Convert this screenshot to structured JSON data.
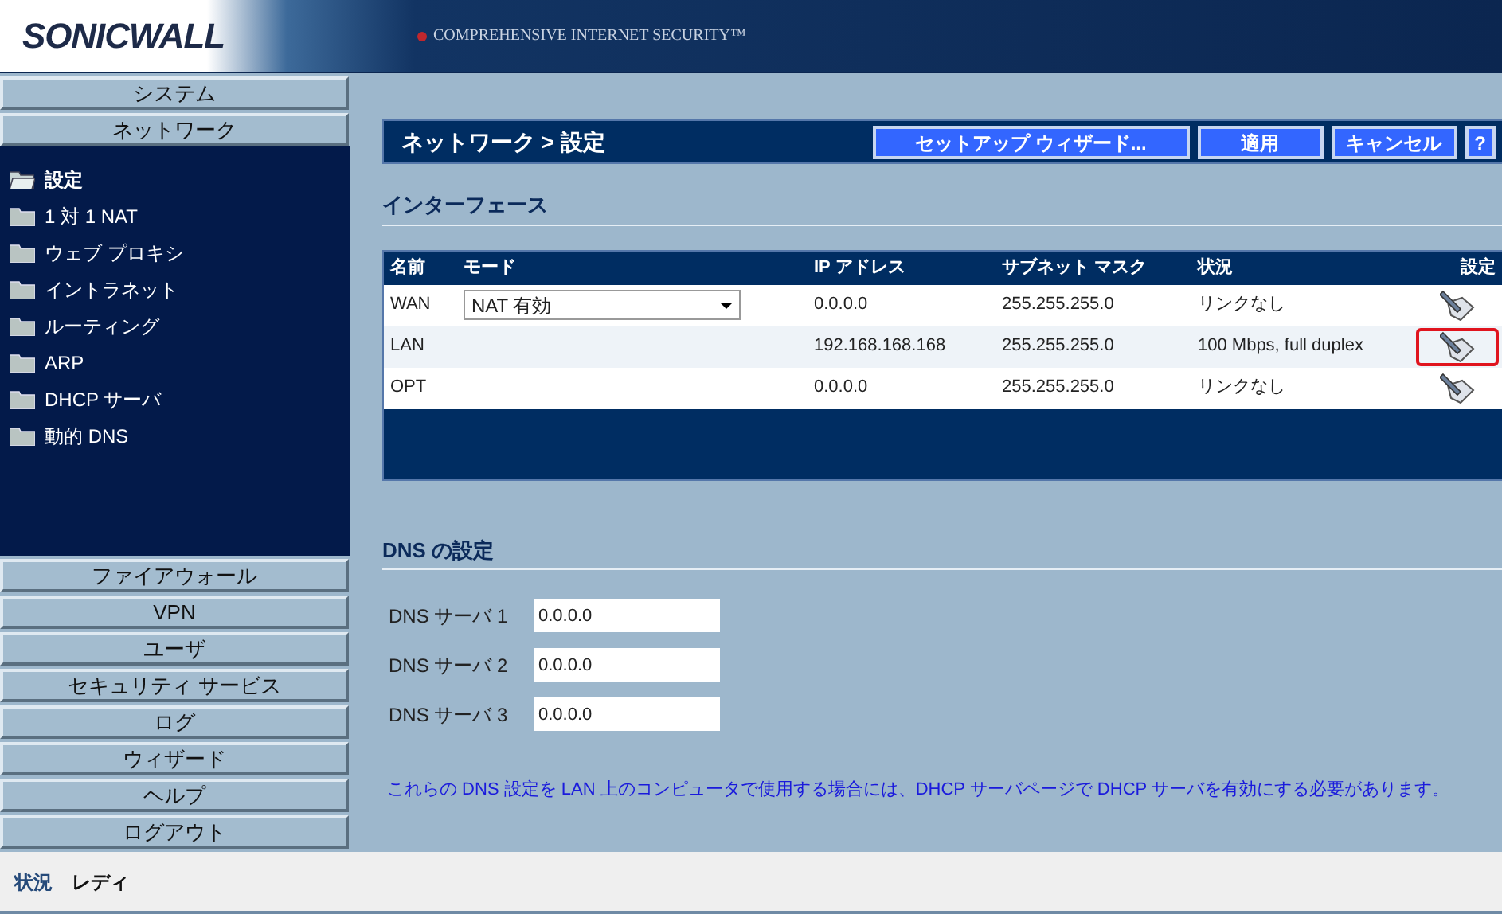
{
  "header": {
    "logo": "SONICWALL",
    "tagline": "COMPREHENSIVE INTERNET SECURITY™"
  },
  "nav_top": [
    {
      "label": "システム"
    },
    {
      "label": "ネットワーク"
    }
  ],
  "nav_tree": [
    {
      "label": "設定",
      "selected": true
    },
    {
      "label": "1 対 1 NAT",
      "selected": false
    },
    {
      "label": "ウェブ プロキシ",
      "selected": false
    },
    {
      "label": "イントラネット",
      "selected": false
    },
    {
      "label": "ルーティング",
      "selected": false
    },
    {
      "label": "ARP",
      "selected": false
    },
    {
      "label": "DHCP サーバ",
      "selected": false
    },
    {
      "label": "動的 DNS",
      "selected": false
    }
  ],
  "nav_bottom": [
    {
      "label": "ファイアウォール"
    },
    {
      "label": "VPN"
    },
    {
      "label": "ユーザ"
    },
    {
      "label": "セキュリティ サービス"
    },
    {
      "label": "ログ"
    },
    {
      "label": "ウィザード"
    },
    {
      "label": "ヘルプ"
    },
    {
      "label": "ログアウト"
    }
  ],
  "page": {
    "title": "ネットワーク > 設定",
    "buttons": [
      "セットアップ ウィザード...",
      "適用",
      "キャンセル",
      "?"
    ]
  },
  "interfaces": {
    "title": "インターフェース",
    "columns": [
      "名前",
      "モード",
      "IP アドレス",
      "サブネット マスク",
      "状況",
      "設定"
    ],
    "rows": [
      {
        "name": "WAN",
        "mode": "NAT 有効",
        "ip": "0.0.0.0",
        "mask": "255.255.255.0",
        "status": "リンクなし",
        "highlighted": false
      },
      {
        "name": "LAN",
        "ip": "192.168.168.168",
        "mask": "255.255.255.0",
        "status": "100 Mbps, full duplex",
        "highlighted": true
      },
      {
        "name": "OPT",
        "ip": "0.0.0.0",
        "mask": "255.255.255.0",
        "status": "リンクなし",
        "highlighted": false
      }
    ]
  },
  "dns": {
    "title": "DNS の設定",
    "fields": [
      {
        "label": "DNS サーバ 1",
        "value": "0.0.0.0"
      },
      {
        "label": "DNS サーバ 2",
        "value": "0.0.0.0"
      },
      {
        "label": "DNS サーバ 3",
        "value": "0.0.0.0"
      }
    ],
    "note": "これらの DNS 設定を LAN 上のコンピュータで使用する場合には、DHCP サーバページで DHCP サーバを有効にする必要があります。"
  },
  "status_bar": {
    "label": "状況",
    "value": "レディ"
  }
}
